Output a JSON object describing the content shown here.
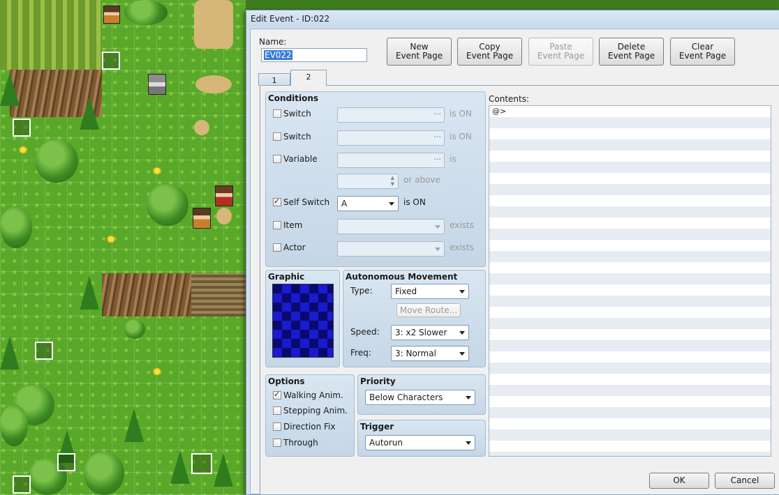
{
  "dialog": {
    "title": "Edit Event - ID:022"
  },
  "name": {
    "label": "Name:",
    "value": "EV022"
  },
  "toolbar": {
    "new_page": [
      "New",
      "Event Page"
    ],
    "copy_page": [
      "Copy",
      "Event Page"
    ],
    "paste_page": [
      "Paste",
      "Event Page"
    ],
    "delete_page": [
      "Delete",
      "Event Page"
    ],
    "clear_page": [
      "Clear",
      "Event Page"
    ]
  },
  "tabs": [
    {
      "label": "1",
      "active": false
    },
    {
      "label": "2",
      "active": true
    }
  ],
  "conditions": {
    "title": "Conditions",
    "switch1": {
      "label": "Switch",
      "suffix": "is ON",
      "checked": false
    },
    "switch2": {
      "label": "Switch",
      "suffix": "is ON",
      "checked": false
    },
    "variable": {
      "label": "Variable",
      "suffix": "is",
      "above": "or above",
      "checked": false
    },
    "self_switch": {
      "label": "Self Switch",
      "value": "A",
      "suffix": "is ON",
      "checked": true
    },
    "item": {
      "label": "Item",
      "suffix": "exists",
      "checked": false
    },
    "actor": {
      "label": "Actor",
      "suffix": "exists",
      "checked": false
    }
  },
  "graphic": {
    "title": "Graphic"
  },
  "movement": {
    "title": "Autonomous Movement",
    "type_label": "Type:",
    "type_value": "Fixed",
    "move_route": "Move Route...",
    "speed_label": "Speed:",
    "speed_value": "3: x2 Slower",
    "freq_label": "Freq:",
    "freq_value": "3: Normal"
  },
  "options": {
    "title": "Options",
    "walking": {
      "label": "Walking Anim.",
      "checked": true
    },
    "stepping": {
      "label": "Stepping Anim.",
      "checked": false
    },
    "direction_fix": {
      "label": "Direction Fix",
      "checked": false
    },
    "through": {
      "label": "Through",
      "checked": false
    }
  },
  "priority": {
    "title": "Priority",
    "value": "Below Characters"
  },
  "trigger": {
    "title": "Trigger",
    "value": "Autorun"
  },
  "contents": {
    "label": "Contents:",
    "first_line": "@>"
  },
  "footer": {
    "ok": "OK",
    "cancel": "Cancel"
  }
}
